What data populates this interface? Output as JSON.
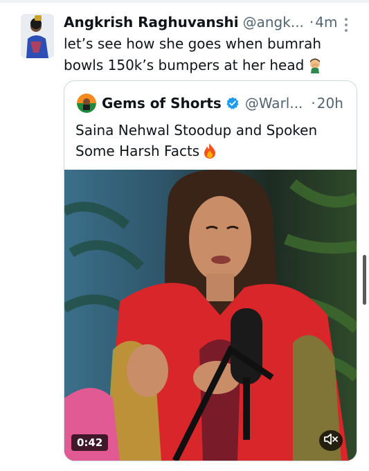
{
  "tweet": {
    "author_name": "Angkrish Raghuvanshi",
    "author_handle": "@angk...",
    "separator": "·",
    "time": "4m",
    "text": "let’s see how she goes when bumrah bowls 150k’s bumpers at her head",
    "emoji_icon": "facepalm-emoji"
  },
  "quote": {
    "author_name": "Gems of Shorts",
    "author_handle": "@Warl...",
    "separator": "·",
    "time": "20h",
    "verified": true,
    "text": "Saina Nehwal Stoodup and Spoken Some Harsh Facts",
    "emoji_icon": "fire-emoji",
    "video": {
      "duration": "0:42",
      "muted": true
    }
  },
  "colors": {
    "text_primary": "#0f1419",
    "text_secondary": "#536471",
    "border": "#cfd9de",
    "verified_blue": "#1d9bf0"
  }
}
